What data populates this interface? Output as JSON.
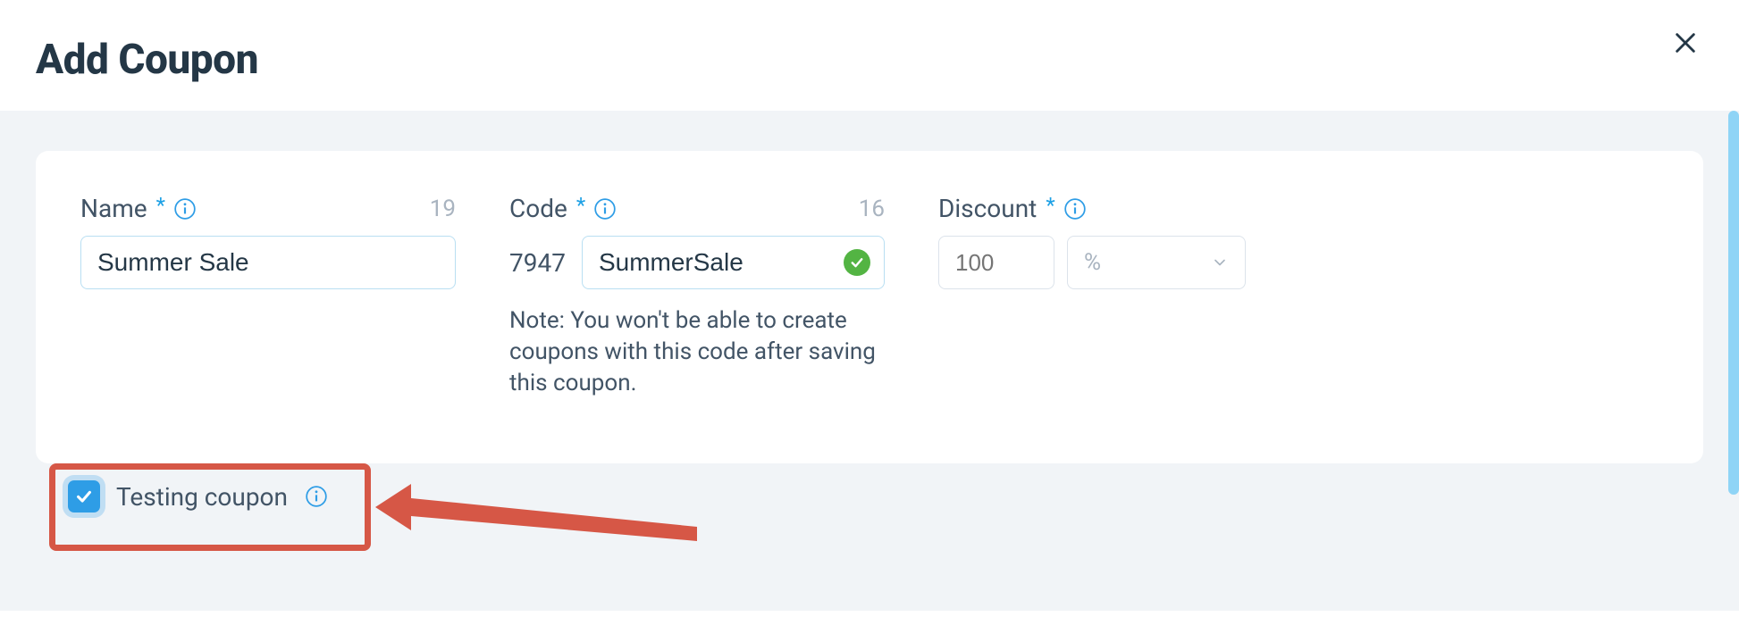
{
  "header": {
    "title": "Add Coupon"
  },
  "form": {
    "name": {
      "label": "Name",
      "counter": "19",
      "value": "Summer Sale"
    },
    "code": {
      "label": "Code",
      "counter": "16",
      "prefix": "7947",
      "value": "SummerSale",
      "note": "Note: You won't be able to create coupons with this code after saving this coupon."
    },
    "discount": {
      "label": "Discount",
      "placeholder": "100",
      "unit": "%"
    },
    "testing": {
      "label": "Testing coupon",
      "checked": true
    }
  }
}
